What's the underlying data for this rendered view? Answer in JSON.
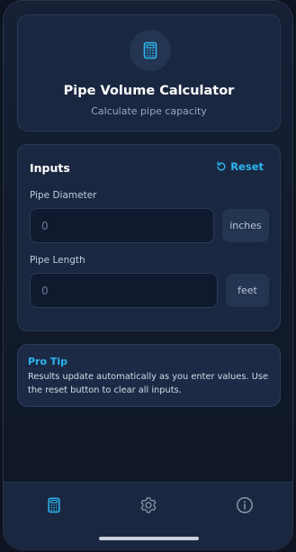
{
  "header": {
    "title": "Pipe Volume Calculator",
    "subtitle": "Calculate pipe capacity",
    "icon": "calculator-icon"
  },
  "inputs": {
    "section_title": "Inputs",
    "reset_label": "Reset",
    "diameter": {
      "label": "Pipe Diameter",
      "placeholder": "0",
      "value": "",
      "unit": "inches"
    },
    "length": {
      "label": "Pipe Length",
      "placeholder": "0",
      "value": "",
      "unit": "feet"
    }
  },
  "tip": {
    "title": "Pro Tip",
    "body": "Results update automatically as you enter values. Use the reset button to clear all inputs."
  },
  "tabbar": {
    "items": [
      {
        "icon": "calculator-icon",
        "active": true
      },
      {
        "icon": "gear-icon",
        "active": false
      },
      {
        "icon": "info-icon",
        "active": false
      }
    ]
  },
  "colors": {
    "accent": "#2bb7f0",
    "background": "#0d1320",
    "card": "#1a2740"
  }
}
